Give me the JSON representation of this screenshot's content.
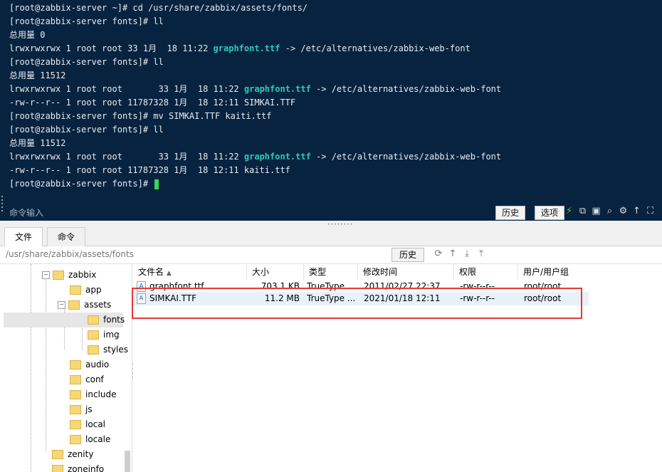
{
  "terminal": {
    "lines": [
      {
        "before": "[root@zabbix-server ~]# cd /usr/share/zabbix/assets/fonts/",
        "hl": "",
        "after": ""
      },
      {
        "before": "[root@zabbix-server fonts]# ll",
        "hl": "",
        "after": ""
      },
      {
        "before": "总用量 0",
        "hl": "",
        "after": ""
      },
      {
        "before": "lrwxrwxrwx 1 root root 33 1月  18 11:22 ",
        "hl": "graphfont.ttf",
        "after": " -> /etc/alternatives/zabbix-web-font"
      },
      {
        "before": "[root@zabbix-server fonts]# ll",
        "hl": "",
        "after": ""
      },
      {
        "before": "总用量 11512",
        "hl": "",
        "after": ""
      },
      {
        "before": "lrwxrwxrwx 1 root root       33 1月  18 11:22 ",
        "hl": "graphfont.ttf",
        "after": " -> /etc/alternatives/zabbix-web-font"
      },
      {
        "before": "-rw-r--r-- 1 root root 11787328 1月  18 12:11 SIMKAI.TTF",
        "hl": "",
        "after": ""
      },
      {
        "before": "[root@zabbix-server fonts]# mv SIMKAI.TTF kaiti.ttf",
        "hl": "",
        "after": ""
      },
      {
        "before": "[root@zabbix-server fonts]# ll",
        "hl": "",
        "after": ""
      },
      {
        "before": "总用量 11512",
        "hl": "",
        "after": ""
      },
      {
        "before": "lrwxrwxrwx 1 root root       33 1月  18 11:22 ",
        "hl": "graphfont.ttf",
        "after": " -> /etc/alternatives/zabbix-web-font"
      },
      {
        "before": "-rw-r--r-- 1 root root 11787328 1月  18 12:11 kaiti.ttf",
        "hl": "",
        "after": ""
      },
      {
        "before": "[root@zabbix-server fonts]# ",
        "hl": "",
        "after": ""
      }
    ],
    "cmd_label": "命令输入",
    "history_label": "历史",
    "options_label": "选项",
    "icons": [
      "lightning-icon",
      "copy-icon",
      "paste-icon",
      "search-icon",
      "settings-icon",
      "upload-icon",
      "fullscreen-icon"
    ]
  },
  "tabs": [
    {
      "label": "文件"
    },
    {
      "label": "命令"
    }
  ],
  "pathbar": {
    "path": "/usr/share/zabbix/assets/fonts",
    "history_label": "历史"
  },
  "tree": [
    {
      "label": "zabbix",
      "expander": "−"
    },
    {
      "label": "app"
    },
    {
      "label": "assets",
      "expander": "−"
    },
    {
      "label": "fonts"
    },
    {
      "label": "img"
    },
    {
      "label": "styles"
    },
    {
      "label": "audio"
    },
    {
      "label": "conf"
    },
    {
      "label": "include"
    },
    {
      "label": "js"
    },
    {
      "label": "local"
    },
    {
      "label": "locale"
    },
    {
      "label": "zenity"
    },
    {
      "label": "zoneinfo"
    }
  ],
  "filelist": {
    "headers": {
      "name": "文件名",
      "size": "大小",
      "type": "类型",
      "mtime": "修改时间",
      "perm": "权限",
      "owner": "用户/用户组"
    },
    "rows": [
      {
        "name": "graphfont.ttf",
        "size": "703.1 KB",
        "type": "TrueType ...",
        "mtime": "2011/02/27 22:37",
        "perm": "-rw-r--r--",
        "owner": "root/root"
      },
      {
        "name": "SIMKAI.TTF",
        "size": "11.2 MB",
        "type": "TrueType ...",
        "mtime": "2021/01/18 12:11",
        "perm": "-rw-r--r--",
        "owner": "root/root"
      }
    ]
  },
  "colors": {
    "terminal_bg": "#08233f",
    "filename_highlight": "#2fc9b8",
    "cursor": "#39d65c",
    "annotation_box": "#e53935"
  }
}
